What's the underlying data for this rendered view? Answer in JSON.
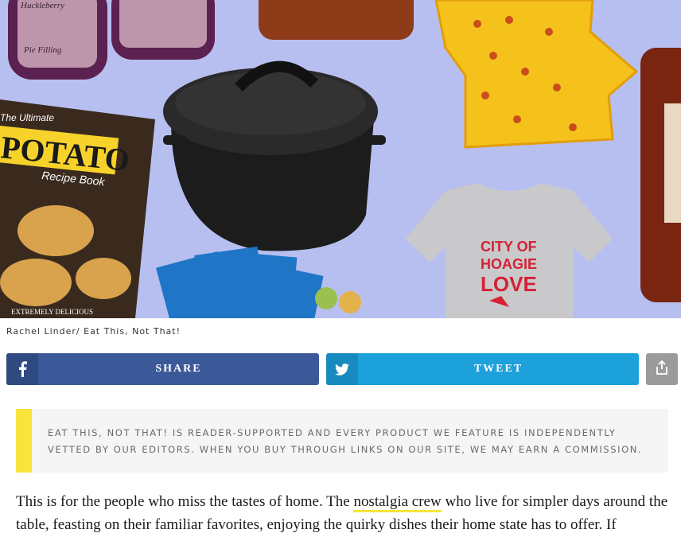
{
  "hero": {
    "image_credit": "Rachel Linder/ Eat This, Not That!",
    "product_texts": {
      "jar_label_1": "Huckleberry",
      "jar_label_2": "Pie Filling",
      "book_title_top": "The Ultimate",
      "book_title_main": "POTATO",
      "book_subtitle": "Recipe Book",
      "book_tag": "EXTREMELY DELICIOUS",
      "shirt_line_1": "CITY OF",
      "shirt_line_2": "HOAGIE",
      "shirt_line_3": "LOVE"
    }
  },
  "share": {
    "facebook_label": "SHARE",
    "twitter_label": "TWEET"
  },
  "disclaimer": {
    "text": "EAT THIS, NOT THAT! IS READER-SUPPORTED AND EVERY PRODUCT WE FEATURE IS INDEPENDENTLY VETTED BY OUR EDITORS. WHEN YOU BUY THROUGH LINKS ON OUR SITE, WE MAY EARN A COMMISSION."
  },
  "article": {
    "intro_before_link": "This is for the people who miss the tastes of home. The ",
    "link_text": "nostalgia crew",
    "intro_after_link": " who live for simpler days around the table, feasting on their familiar favorites, enjoying the quirky dishes their home state has to offer. If"
  },
  "colors": {
    "hero_bg": "#b7bff0",
    "facebook": "#3b5998",
    "twitter": "#1da1db",
    "accent_yellow": "#f9e43b"
  }
}
